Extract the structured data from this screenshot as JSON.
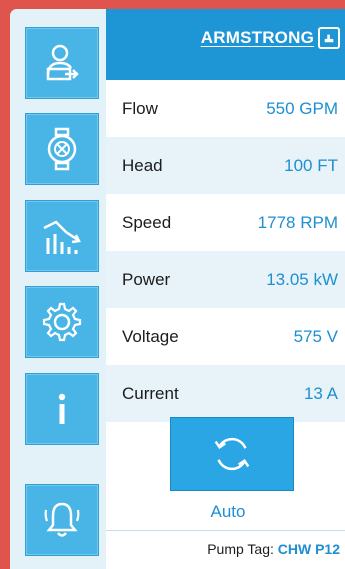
{
  "brand": {
    "name": "ARMSTRONG"
  },
  "sidebar": {
    "items": [
      {
        "icon": "user-logout-icon"
      },
      {
        "icon": "pump-icon"
      },
      {
        "icon": "trend-chart-icon"
      },
      {
        "icon": "gear-icon"
      },
      {
        "icon": "info-icon"
      },
      {
        "icon": "bell-alarm-icon"
      }
    ]
  },
  "readings": [
    {
      "label": "Flow",
      "value": "550 GPM"
    },
    {
      "label": "Head",
      "value": "100 FT"
    },
    {
      "label": "Speed",
      "value": "1778 RPM"
    },
    {
      "label": "Power",
      "value": "13.05 kW"
    },
    {
      "label": "Voltage",
      "value": "575 V"
    },
    {
      "label": "Current",
      "value": "13 A"
    }
  ],
  "mode": {
    "label": "Auto",
    "icon": "refresh-icon"
  },
  "pump_tag": {
    "label": "Pump Tag:",
    "value": "CHW P12"
  },
  "colors": {
    "accent": "#1e95d5",
    "value_text": "#1e8fd0",
    "frame": "#e0544e"
  }
}
